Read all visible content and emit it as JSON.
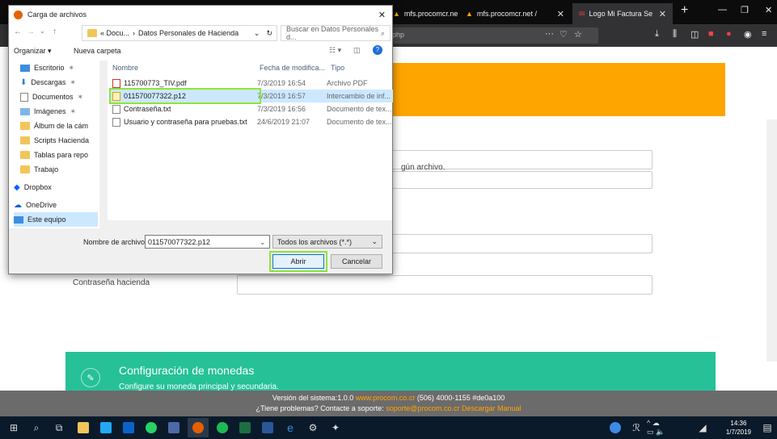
{
  "browser": {
    "tabs": [
      {
        "label": "mfs.procomcr.net /"
      },
      {
        "label": "mfs.procomcr.net /"
      },
      {
        "label": "Logo Mi Factura Se"
      }
    ],
    "url": "racion.php",
    "new_tab": "+"
  },
  "page": {
    "file_status": "gún archivo.",
    "password_label": "Contraseña hacienda",
    "card_title": "Configuración de monedas",
    "card_subtitle": "Configure su moneda principal y secundaria.",
    "footer_line1_prefix": "Versión del sistema:1.0.0",
    "footer_line1_link": "www.procom.co.cr",
    "footer_line1_suffix": "(506) 4000-1155 #de0a100",
    "footer_line2_prefix": "¿Tiene problemas? Contacte a soporte:",
    "footer_line2_link": "soporte@procom.co.cr Descargar Manual"
  },
  "dialog": {
    "title": "Carga de archivos",
    "breadcrumb": [
      "« Docu...",
      "›",
      "Datos Personales de Hacienda"
    ],
    "search_placeholder": "Buscar en Datos Personales d...",
    "organize": "Organizar ▾",
    "new_folder": "Nueva carpeta",
    "nav_items": [
      {
        "label": "Escritorio"
      },
      {
        "label": "Descargas"
      },
      {
        "label": "Documentos"
      },
      {
        "label": "Imágenes"
      },
      {
        "label": "Álbum de la cám"
      },
      {
        "label": "Scripts Hacienda"
      },
      {
        "label": "Tablas para repo"
      },
      {
        "label": "Trabajo"
      },
      {
        "label": "Dropbox"
      },
      {
        "label": "OneDrive"
      },
      {
        "label": "Este equipo"
      }
    ],
    "columns": {
      "name": "Nombre",
      "date": "Fecha de modifica...",
      "type": "Tipo"
    },
    "files": [
      {
        "name": "115700773_TIV.pdf",
        "date": "7/3/2019 16:54",
        "type": "Archivo PDF"
      },
      {
        "name": "011570077322.p12",
        "date": "7/3/2019 16:57",
        "type": "Intercambio de inf..."
      },
      {
        "name": "Contraseña.txt",
        "date": "7/3/2019 16:56",
        "type": "Documento de tex..."
      },
      {
        "name": "Usuario y contraseña para pruebas.txt",
        "date": "24/6/2019 21:07",
        "type": "Documento de tex..."
      }
    ],
    "filename_label": "Nombre de archivo:",
    "filename_value": "011570077322.p12",
    "filter_value": "Todos los archivos (*.*)",
    "open_button": "Abrir",
    "cancel_button": "Cancelar"
  },
  "taskbar": {
    "time": "14:36",
    "date": "1/7/2019"
  },
  "colors": {
    "accent_orange": "#ffa500",
    "card_green": "#26c197",
    "highlight": "#8ee43a"
  }
}
